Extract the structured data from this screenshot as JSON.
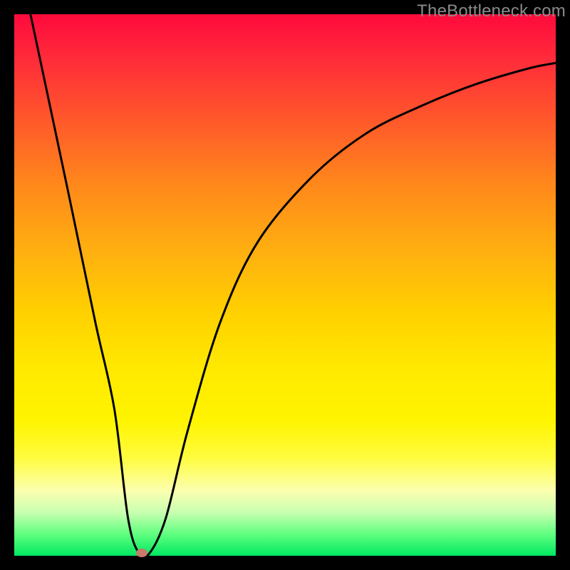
{
  "watermark": "TheBottleneck.com",
  "chart_data": {
    "type": "line",
    "title": "",
    "xlabel": "",
    "ylabel": "",
    "xlim": [
      0,
      100
    ],
    "ylim": [
      0,
      100
    ],
    "series": [
      {
        "name": "curve",
        "x": [
          3,
          10,
          15,
          18.5,
          21,
          23,
          25,
          28,
          32,
          38,
          45,
          55,
          65,
          75,
          85,
          95,
          100
        ],
        "y": [
          100,
          67,
          43,
          27,
          7,
          0.5,
          0.5,
          7,
          23,
          43,
          58,
          70,
          78,
          83,
          87,
          90,
          91
        ]
      }
    ],
    "marker": {
      "x": 23.5,
      "y": 0.5
    },
    "background_gradient": {
      "stops": [
        {
          "pos": 0.0,
          "color": "#ff0a3c"
        },
        {
          "pos": 0.2,
          "color": "#ff5a2a"
        },
        {
          "pos": 0.45,
          "color": "#ffb010"
        },
        {
          "pos": 0.7,
          "color": "#ffe800"
        },
        {
          "pos": 0.9,
          "color": "#c8ffb0"
        },
        {
          "pos": 1.0,
          "color": "#00e860"
        }
      ]
    }
  }
}
